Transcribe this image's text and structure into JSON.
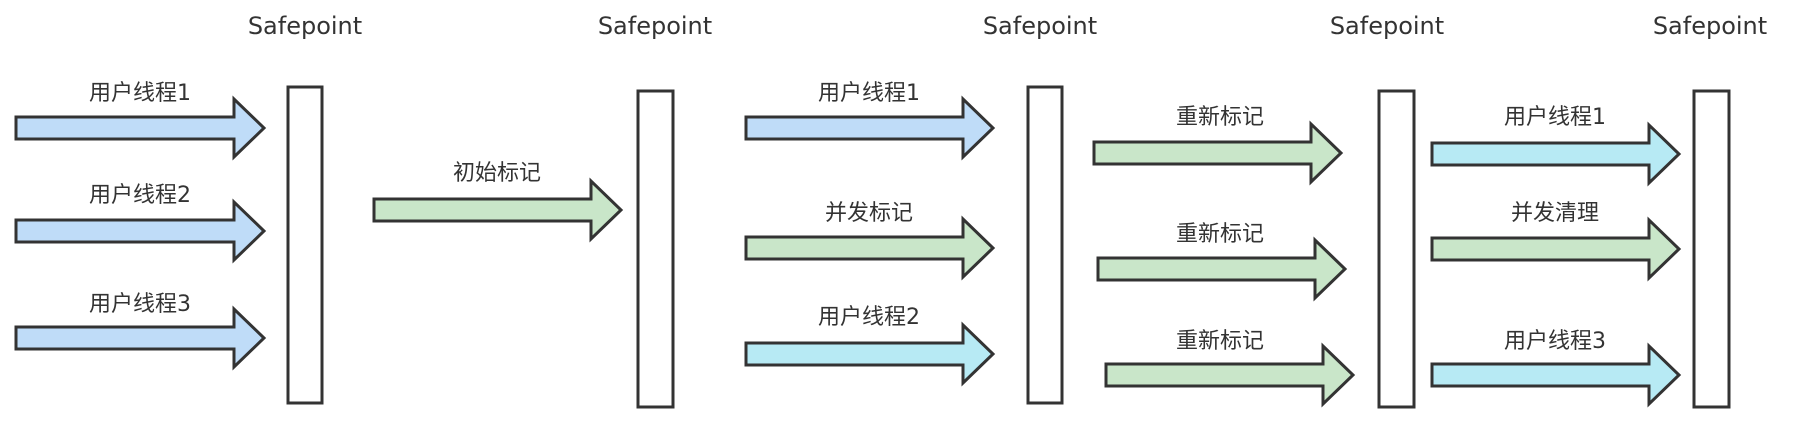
{
  "colors": {
    "blue": "#bfdcf8",
    "cyan": "#b7eaf4",
    "green": "#c9e6c9",
    "stroke": "#333333"
  },
  "safepoints": [
    "Safepoint",
    "Safepoint",
    "Safepoint",
    "Safepoint",
    "Safepoint"
  ],
  "stages": [
    {
      "arrows": [
        {
          "label": "用户线程1",
          "color": "blue"
        },
        {
          "label": "用户线程2",
          "color": "blue"
        },
        {
          "label": "用户线程3",
          "color": "blue"
        }
      ]
    },
    {
      "arrows": [
        {
          "label": "初始标记",
          "color": "green"
        }
      ]
    },
    {
      "arrows": [
        {
          "label": "用户线程1",
          "color": "blue"
        },
        {
          "label": "并发标记",
          "color": "green"
        },
        {
          "label": "用户线程2",
          "color": "cyan"
        }
      ]
    },
    {
      "arrows": [
        {
          "label": "重新标记",
          "color": "green"
        },
        {
          "label": "重新标记",
          "color": "green"
        },
        {
          "label": "重新标记",
          "color": "green"
        }
      ]
    },
    {
      "arrows": [
        {
          "label": "用户线程1",
          "color": "cyan"
        },
        {
          "label": "并发清理",
          "color": "green"
        },
        {
          "label": "用户线程3",
          "color": "cyan"
        }
      ]
    }
  ]
}
